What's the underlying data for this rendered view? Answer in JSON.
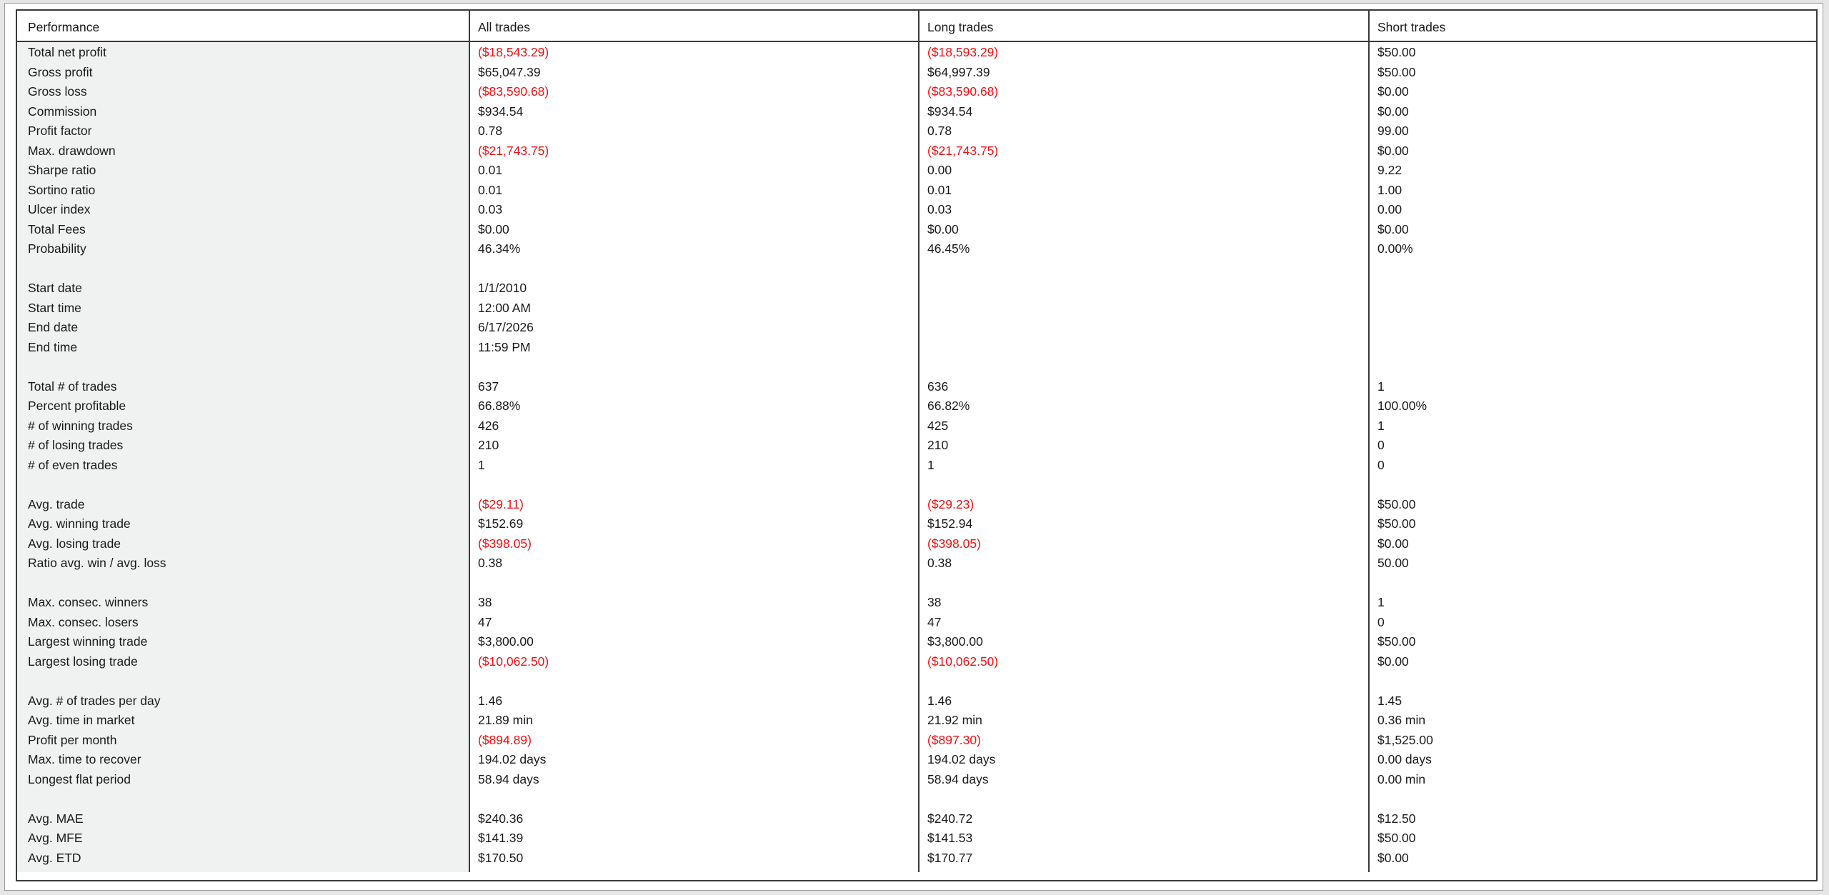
{
  "headers": [
    "Performance",
    "All trades",
    "Long trades",
    "Short trades"
  ],
  "colors": {
    "negative": "#ee1111",
    "text": "#1a1a1a",
    "label_column_bg": "#f0f1f1"
  },
  "rows": [
    {
      "label": "Total net profit",
      "all": "($18,543.29)",
      "long": "($18,593.29)",
      "short": "$50.00",
      "neg": [
        true,
        true,
        false
      ]
    },
    {
      "label": "Gross profit",
      "all": "$65,047.39",
      "long": "$64,997.39",
      "short": "$50.00",
      "neg": [
        false,
        false,
        false
      ]
    },
    {
      "label": "Gross loss",
      "all": "($83,590.68)",
      "long": "($83,590.68)",
      "short": "$0.00",
      "neg": [
        true,
        true,
        false
      ]
    },
    {
      "label": "Commission",
      "all": "$934.54",
      "long": "$934.54",
      "short": "$0.00",
      "neg": [
        false,
        false,
        false
      ]
    },
    {
      "label": "Profit factor",
      "all": "0.78",
      "long": "0.78",
      "short": "99.00",
      "neg": [
        false,
        false,
        false
      ]
    },
    {
      "label": "Max. drawdown",
      "all": "($21,743.75)",
      "long": "($21,743.75)",
      "short": "$0.00",
      "neg": [
        true,
        true,
        false
      ]
    },
    {
      "label": "Sharpe ratio",
      "all": "0.01",
      "long": "0.00",
      "short": "9.22",
      "neg": [
        false,
        false,
        false
      ]
    },
    {
      "label": "Sortino ratio",
      "all": "0.01",
      "long": "0.01",
      "short": "1.00",
      "neg": [
        false,
        false,
        false
      ]
    },
    {
      "label": "Ulcer index",
      "all": "0.03",
      "long": "0.03",
      "short": "0.00",
      "neg": [
        false,
        false,
        false
      ]
    },
    {
      "label": "Total Fees",
      "all": "$0.00",
      "long": "$0.00",
      "short": "$0.00",
      "neg": [
        false,
        false,
        false
      ]
    },
    {
      "label": "Probability",
      "all": "46.34%",
      "long": "46.45%",
      "short": "0.00%",
      "neg": [
        false,
        false,
        false
      ]
    },
    null,
    {
      "label": "Start date",
      "all": "1/1/2010",
      "long": "",
      "short": "",
      "neg": [
        false,
        false,
        false
      ]
    },
    {
      "label": "Start time",
      "all": "12:00 AM",
      "long": "",
      "short": "",
      "neg": [
        false,
        false,
        false
      ]
    },
    {
      "label": "End date",
      "all": "6/17/2026",
      "long": "",
      "short": "",
      "neg": [
        false,
        false,
        false
      ]
    },
    {
      "label": "End time",
      "all": "11:59 PM",
      "long": "",
      "short": "",
      "neg": [
        false,
        false,
        false
      ]
    },
    null,
    {
      "label": "Total # of trades",
      "all": "637",
      "long": "636",
      "short": "1",
      "neg": [
        false,
        false,
        false
      ]
    },
    {
      "label": "Percent profitable",
      "all": "66.88%",
      "long": "66.82%",
      "short": "100.00%",
      "neg": [
        false,
        false,
        false
      ]
    },
    {
      "label": "# of winning trades",
      "all": "426",
      "long": "425",
      "short": "1",
      "neg": [
        false,
        false,
        false
      ]
    },
    {
      "label": "# of losing trades",
      "all": "210",
      "long": "210",
      "short": "0",
      "neg": [
        false,
        false,
        false
      ]
    },
    {
      "label": "# of even trades",
      "all": "1",
      "long": "1",
      "short": "0",
      "neg": [
        false,
        false,
        false
      ]
    },
    null,
    {
      "label": "Avg. trade",
      "all": "($29.11)",
      "long": "($29.23)",
      "short": "$50.00",
      "neg": [
        true,
        true,
        false
      ]
    },
    {
      "label": "Avg. winning trade",
      "all": "$152.69",
      "long": "$152.94",
      "short": "$50.00",
      "neg": [
        false,
        false,
        false
      ]
    },
    {
      "label": "Avg. losing trade",
      "all": "($398.05)",
      "long": "($398.05)",
      "short": "$0.00",
      "neg": [
        true,
        true,
        false
      ]
    },
    {
      "label": "Ratio avg. win / avg. loss",
      "all": "0.38",
      "long": "0.38",
      "short": "50.00",
      "neg": [
        false,
        false,
        false
      ]
    },
    null,
    {
      "label": "Max. consec. winners",
      "all": "38",
      "long": "38",
      "short": "1",
      "neg": [
        false,
        false,
        false
      ]
    },
    {
      "label": "Max. consec. losers",
      "all": "47",
      "long": "47",
      "short": "0",
      "neg": [
        false,
        false,
        false
      ]
    },
    {
      "label": "Largest winning trade",
      "all": "$3,800.00",
      "long": "$3,800.00",
      "short": "$50.00",
      "neg": [
        false,
        false,
        false
      ]
    },
    {
      "label": "Largest losing trade",
      "all": "($10,062.50)",
      "long": "($10,062.50)",
      "short": "$0.00",
      "neg": [
        true,
        true,
        false
      ]
    },
    null,
    {
      "label": "Avg. # of trades per day",
      "all": "1.46",
      "long": "1.46",
      "short": "1.45",
      "neg": [
        false,
        false,
        false
      ]
    },
    {
      "label": "Avg. time in market",
      "all": "21.89 min",
      "long": "21.92 min",
      "short": "0.36 min",
      "neg": [
        false,
        false,
        false
      ]
    },
    {
      "label": "Profit per month",
      "all": "($894.89)",
      "long": "($897.30)",
      "short": "$1,525.00",
      "neg": [
        true,
        true,
        false
      ]
    },
    {
      "label": "Max. time to recover",
      "all": "194.02 days",
      "long": "194.02 days",
      "short": "0.00 days",
      "neg": [
        false,
        false,
        false
      ]
    },
    {
      "label": "Longest flat period",
      "all": "58.94 days",
      "long": "58.94 days",
      "short": "0.00 min",
      "neg": [
        false,
        false,
        false
      ]
    },
    null,
    {
      "label": "Avg. MAE",
      "all": "$240.36",
      "long": "$240.72",
      "short": "$12.50",
      "neg": [
        false,
        false,
        false
      ]
    },
    {
      "label": "Avg. MFE",
      "all": "$141.39",
      "long": "$141.53",
      "short": "$50.00",
      "neg": [
        false,
        false,
        false
      ]
    },
    {
      "label": "Avg. ETD",
      "all": "$170.50",
      "long": "$170.77",
      "short": "$0.00",
      "neg": [
        false,
        false,
        false
      ]
    }
  ]
}
